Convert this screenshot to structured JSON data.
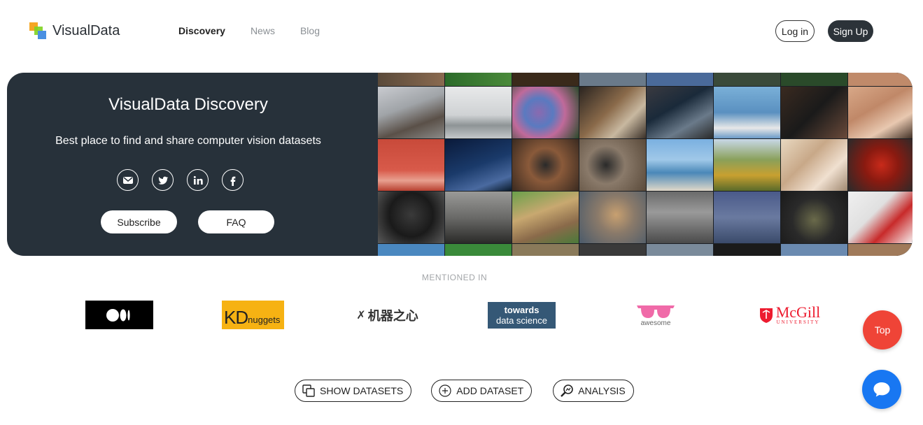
{
  "brand": {
    "name": "VisualData"
  },
  "nav": {
    "items": [
      {
        "label": "Discovery",
        "active": true
      },
      {
        "label": "News",
        "active": false
      },
      {
        "label": "Blog",
        "active": false
      }
    ]
  },
  "auth": {
    "login_label": "Log in",
    "signup_label": "Sign Up"
  },
  "hero": {
    "title": "VisualData Discovery",
    "subtitle": "Best place to find and share computer vision datasets",
    "socials": [
      "email-icon",
      "twitter-icon",
      "linkedin-icon",
      "facebook-icon"
    ],
    "subscribe_label": "Subscribe",
    "faq_label": "FAQ"
  },
  "mentioned": {
    "label": "MENTIONED IN",
    "logos": {
      "kd_prefix": "KD",
      "kd_suffix": "nuggets",
      "jiqi": "机器之心",
      "tds_line1": "towards",
      "tds_line2": "data science",
      "awesome": "awesome",
      "mcgill": "McGill",
      "mcgill_sub": "UNIVERSITY"
    }
  },
  "actions": {
    "show_datasets": "SHOW DATASETS",
    "add_dataset": "ADD DATASET",
    "analysis": "ANALYSIS"
  },
  "fab": {
    "top_label": "Top"
  },
  "colors": {
    "hero_bg": "#27313a",
    "signup_bg": "#2c3339",
    "top_fab": "#ef4437",
    "chat_fab": "#1877f2"
  }
}
